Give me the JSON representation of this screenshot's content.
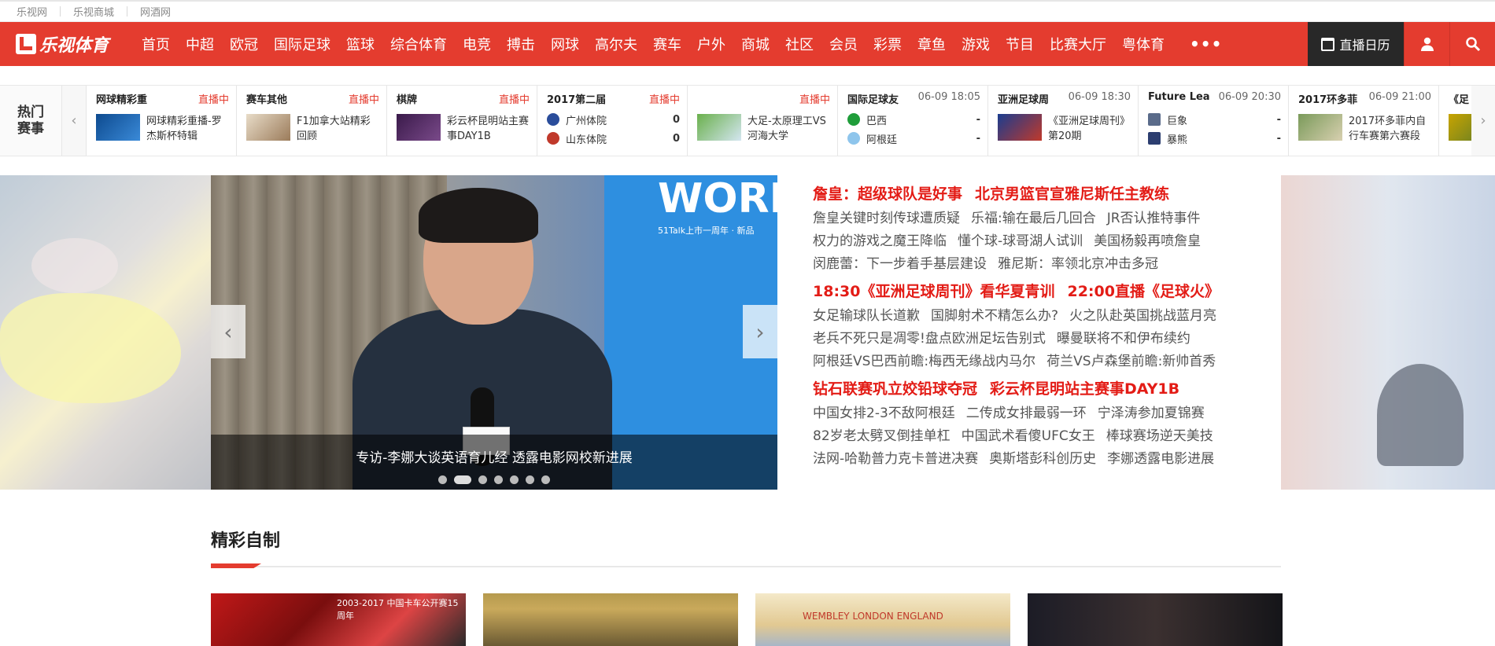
{
  "topbar": {
    "links": [
      "乐视网",
      "乐视商城",
      "网酒网"
    ]
  },
  "nav": {
    "logo_text": "乐视体育",
    "items": [
      "首页",
      "中超",
      "欧冠",
      "国际足球",
      "篮球",
      "综合体育",
      "电竞",
      "搏击",
      "网球",
      "高尔夫",
      "赛车",
      "户外",
      "商城",
      "社区",
      "会员",
      "彩票",
      "章鱼",
      "游戏",
      "节目",
      "比赛大厅",
      "粤体育"
    ],
    "more": "•••",
    "calendar": "直播日历"
  },
  "hot": {
    "title_l1": "热门",
    "title_l2": "赛事",
    "cards": [
      {
        "name": "网球精彩重",
        "live": "直播中",
        "desc": "网球精彩重播-罗杰斯杯特辑"
      },
      {
        "name": "赛车其他",
        "live": "直播中",
        "desc": "F1加拿大站精彩回顾"
      },
      {
        "name": "棋牌",
        "live": "直播中",
        "desc": "彩云杯昆明站主赛事DAY1B"
      },
      {
        "name": "2017第二届",
        "live": "直播中",
        "team1": "广州体院",
        "score1": "0",
        "team2": "山东体院",
        "score2": "0"
      },
      {
        "name": "",
        "live": "直播中",
        "desc": "大足-太原理工VS河海大学"
      },
      {
        "name": "国际足球友",
        "time": "06-09 18:05",
        "team1": "巴西",
        "score1": "-",
        "team2": "阿根廷",
        "score2": "-"
      },
      {
        "name": "亚洲足球周",
        "time": "06-09 18:30",
        "desc": "《亚洲足球周刊》第20期"
      },
      {
        "name": "Future Lea",
        "time": "06-09 20:30",
        "team1": "巨象",
        "score1": "-",
        "team2": "暴熊",
        "score2": "-"
      },
      {
        "name": "2017环多菲",
        "time": "06-09 21:00",
        "desc": "2017环多菲内自行车赛第六赛段"
      },
      {
        "name": "《足",
        "time": "",
        "desc": ""
      }
    ]
  },
  "hero": {
    "caption": "专访-李娜大谈英语育儿经 透露电影网校新进展",
    "board_big": "WORL",
    "board_small": "51Talk上市一周年 · 新品",
    "news": [
      {
        "headline": [
          "詹皇：超级球队是好事",
          "北京男篮官宣雅尼斯任主教练"
        ],
        "lines": [
          [
            "詹皇关键时刻传球遭质疑",
            "乐福:输在最后几回合",
            "JR否认推特事件"
          ],
          [
            "权力的游戏之魔王降临",
            "懂个球-球哥湖人试训",
            "美国杨毅再喷詹皇"
          ],
          [
            "闵鹿蕾：下一步着手基层建设",
            "雅尼斯：率领北京冲击多冠"
          ]
        ]
      },
      {
        "headline": [
          "18:30《亚洲足球周刊》看华夏青训",
          "22:00直播《足球火》"
        ],
        "lines": [
          [
            "女足输球队长道歉",
            "国脚射术不精怎么办?",
            "火之队赴英国挑战蓝月亮"
          ],
          [
            "老兵不死只是凋零!盘点欧洲足坛告别式",
            "曝曼联将不和伊布续约"
          ],
          [
            "阿根廷VS巴西前瞻:梅西无缘战内马尔",
            "荷兰VS卢森堡前瞻:新帅首秀"
          ]
        ]
      },
      {
        "headline": [
          "钻石联赛巩立姣铅球夺冠",
          "彩云杯昆明站主赛事DAY1B"
        ],
        "lines": [
          [
            "中国女排2-3不敌阿根廷",
            "二传成女排最弱一环",
            "宁泽涛参加夏锦赛"
          ],
          [
            "82岁老太劈叉倒挂单杠",
            "中国武术看傻UFC女王",
            "棒球赛场逆天美技"
          ],
          [
            "法网-哈勒普力克卡普进决赛",
            "奥斯塔彭科创历史",
            "李娜透露电影进展"
          ]
        ]
      }
    ]
  },
  "section": {
    "title": "精彩自制",
    "thumbs": [
      "2003-2017 中国卡车公开赛15周年",
      "",
      "WEMBLEY LONDON ENGLAND",
      ""
    ]
  }
}
